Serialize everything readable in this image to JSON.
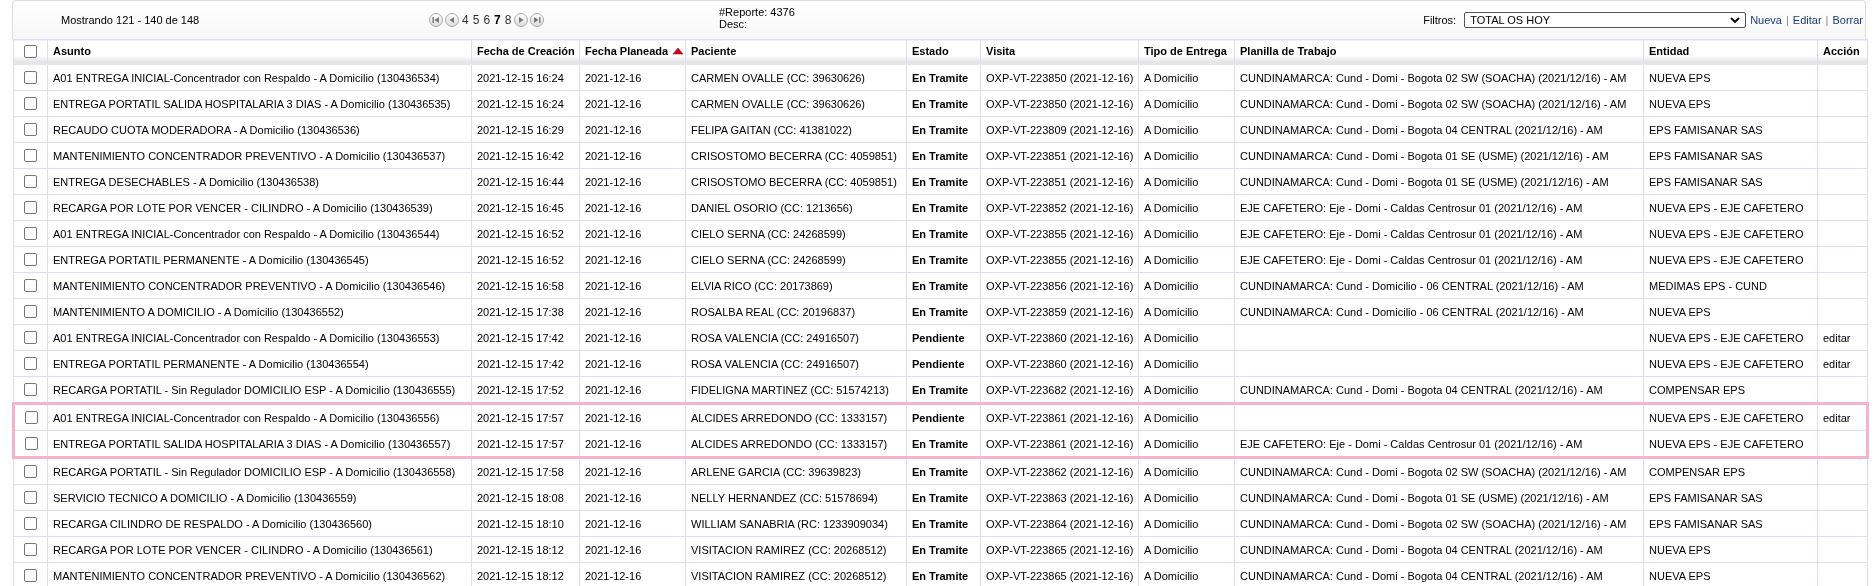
{
  "summary": "Mostrando 121 - 140 de 148",
  "pagination": {
    "pages": [
      {
        "label": "4",
        "selected": false
      },
      {
        "label": "5",
        "selected": false
      },
      {
        "label": "6",
        "selected": false
      },
      {
        "label": "7",
        "selected": true
      },
      {
        "label": "8",
        "selected": false
      }
    ]
  },
  "report": {
    "number": "#Reporte: 4376",
    "desc": "Desc:"
  },
  "filters": {
    "label": "Filtros:",
    "value": "TOTAL OS HOY",
    "links": [
      "Nueva",
      "Editar",
      "Borrar"
    ],
    "separator": "|"
  },
  "table": {
    "select_all_checked": false,
    "columns": [
      {
        "label": "Asunto"
      },
      {
        "label": "Fecha de Creación"
      },
      {
        "label": "Fecha Planeada",
        "sort_ascending": true
      },
      {
        "label": "Paciente"
      },
      {
        "label": "Estado"
      },
      {
        "label": "Visita"
      },
      {
        "label": "Tipo de Entrega"
      },
      {
        "label": "Planilla de Trabajo"
      },
      {
        "label": "Entidad"
      },
      {
        "label": "Acción"
      }
    ],
    "rows": [
      {
        "checked": false,
        "highlighted": false,
        "cells": [
          "A01 ENTREGA INICIAL-Concentrador con Respaldo - A Domicilio (130436534)",
          "2021-12-15 16:24",
          "2021-12-16",
          "CARMEN OVALLE (CC: 39630626)",
          "En Tramite",
          "OXP-VT-223850 (2021-12-16)",
          "A Domicilio",
          "CUNDINAMARCA: Cund - Domi - Bogota 02 SW (SOACHA) (2021/12/16) - AM",
          "NUEVA EPS",
          ""
        ]
      },
      {
        "checked": false,
        "highlighted": false,
        "cells": [
          "ENTREGA PORTATIL SALIDA HOSPITALARIA 3 DIAS - A Domicilio (130436535)",
          "2021-12-15 16:24",
          "2021-12-16",
          "CARMEN OVALLE (CC: 39630626)",
          "En Tramite",
          "OXP-VT-223850 (2021-12-16)",
          "A Domicilio",
          "CUNDINAMARCA: Cund - Domi - Bogota 02 SW (SOACHA) (2021/12/16) - AM",
          "NUEVA EPS",
          ""
        ]
      },
      {
        "checked": false,
        "highlighted": false,
        "cells": [
          "RECAUDO CUOTA MODERADORA - A Domicilio (130436536)",
          "2021-12-15 16:29",
          "2021-12-16",
          "FELIPA GAITAN (CC: 41381022)",
          "En Tramite",
          "OXP-VT-223809 (2021-12-16)",
          "A Domicilio",
          "CUNDINAMARCA: Cund - Domi - Bogota 04 CENTRAL (2021/12/16) - AM",
          "EPS FAMISANAR SAS",
          ""
        ]
      },
      {
        "checked": false,
        "highlighted": false,
        "cells": [
          "MANTENIMIENTO CONCENTRADOR PREVENTIVO - A Domicilio (130436537)",
          "2021-12-15 16:42",
          "2021-12-16",
          "CRISOSTOMO BECERRA (CC: 4059851)",
          "En Tramite",
          "OXP-VT-223851 (2021-12-16)",
          "A Domicilio",
          "CUNDINAMARCA: Cund - Domi - Bogota 01 SE (USME) (2021/12/16) - AM",
          "EPS FAMISANAR SAS",
          ""
        ]
      },
      {
        "checked": false,
        "highlighted": false,
        "cells": [
          "ENTREGA DESECHABLES - A Domicilio (130436538)",
          "2021-12-15 16:44",
          "2021-12-16",
          "CRISOSTOMO BECERRA (CC: 4059851)",
          "En Tramite",
          "OXP-VT-223851 (2021-12-16)",
          "A Domicilio",
          "CUNDINAMARCA: Cund - Domi - Bogota 01 SE (USME) (2021/12/16) - AM",
          "EPS FAMISANAR SAS",
          ""
        ]
      },
      {
        "checked": false,
        "highlighted": false,
        "cells": [
          "RECARGA POR LOTE POR VENCER - CILINDRO - A Domicilio (130436539)",
          "2021-12-15 16:45",
          "2021-12-16",
          "DANIEL OSORIO (CC: 1213656)",
          "En Tramite",
          "OXP-VT-223852 (2021-12-16)",
          "A Domicilio",
          "EJE CAFETERO: Eje - Domi - Caldas Centrosur 01 (2021/12/16) - AM",
          "NUEVA EPS - EJE CAFETERO",
          ""
        ]
      },
      {
        "checked": false,
        "highlighted": false,
        "cells": [
          "A01 ENTREGA INICIAL-Concentrador con Respaldo - A Domicilio (130436544)",
          "2021-12-15 16:52",
          "2021-12-16",
          "CIELO SERNA (CC: 24268599)",
          "En Tramite",
          "OXP-VT-223855 (2021-12-16)",
          "A Domicilio",
          "EJE CAFETERO: Eje - Domi - Caldas Centrosur 01 (2021/12/16) - AM",
          "NUEVA EPS - EJE CAFETERO",
          ""
        ]
      },
      {
        "checked": false,
        "highlighted": false,
        "cells": [
          "ENTREGA PORTATIL PERMANENTE - A Domicilio (130436545)",
          "2021-12-15 16:52",
          "2021-12-16",
          "CIELO SERNA (CC: 24268599)",
          "En Tramite",
          "OXP-VT-223855 (2021-12-16)",
          "A Domicilio",
          "EJE CAFETERO: Eje - Domi - Caldas Centrosur 01 (2021/12/16) - AM",
          "NUEVA EPS - EJE CAFETERO",
          ""
        ]
      },
      {
        "checked": false,
        "highlighted": false,
        "cells": [
          "MANTENIMIENTO CONCENTRADOR PREVENTIVO - A Domicilio (130436546)",
          "2021-12-15 16:58",
          "2021-12-16",
          "ELVIA RICO (CC: 20173869)",
          "En Tramite",
          "OXP-VT-223856 (2021-12-16)",
          "A Domicilio",
          "CUNDINAMARCA: Cund - Domicilio - 06 CENTRAL (2021/12/16) - AM",
          "MEDIMAS EPS - CUND",
          ""
        ]
      },
      {
        "checked": false,
        "highlighted": false,
        "cells": [
          "MANTENIMIENTO A DOMICILIO - A Domicilio (130436552)",
          "2021-12-15 17:38",
          "2021-12-16",
          "ROSALBA REAL (CC: 20196837)",
          "En Tramite",
          "OXP-VT-223859 (2021-12-16)",
          "A Domicilio",
          "CUNDINAMARCA: Cund - Domicilio - 06 CENTRAL (2021/12/16) - AM",
          "NUEVA EPS",
          ""
        ]
      },
      {
        "checked": false,
        "highlighted": false,
        "cells": [
          "A01 ENTREGA INICIAL-Concentrador con Respaldo - A Domicilio (130436553)",
          "2021-12-15 17:42",
          "2021-12-16",
          "ROSA VALENCIA (CC: 24916507)",
          "Pendiente",
          "OXP-VT-223860 (2021-12-16)",
          "A Domicilio",
          "",
          "NUEVA EPS - EJE CAFETERO",
          "editar"
        ]
      },
      {
        "checked": false,
        "highlighted": false,
        "cells": [
          "ENTREGA PORTATIL PERMANENTE - A Domicilio (130436554)",
          "2021-12-15 17:42",
          "2021-12-16",
          "ROSA VALENCIA (CC: 24916507)",
          "Pendiente",
          "OXP-VT-223860 (2021-12-16)",
          "A Domicilio",
          "",
          "NUEVA EPS - EJE CAFETERO",
          "editar"
        ]
      },
      {
        "checked": false,
        "highlighted": false,
        "cells": [
          "RECARGA PORTATIL - Sin Regulador DOMICILIO ESP - A Domicilio (130436555)",
          "2021-12-15 17:52",
          "2021-12-16",
          "FIDELIGNA MARTINEZ (CC: 51574213)",
          "En Tramite",
          "OXP-VT-223682 (2021-12-16)",
          "A Domicilio",
          "CUNDINAMARCA: Cund - Domi - Bogota 04 CENTRAL (2021/12/16) - AM",
          "COMPENSAR EPS",
          ""
        ]
      },
      {
        "checked": false,
        "highlighted": true,
        "cells": [
          "A01 ENTREGA INICIAL-Concentrador con Respaldo - A Domicilio (130436556)",
          "2021-12-15 17:57",
          "2021-12-16",
          "ALCIDES ARREDONDO (CC: 1333157)",
          "Pendiente",
          "OXP-VT-223861 (2021-12-16)",
          "A Domicilio",
          "",
          "NUEVA EPS - EJE CAFETERO",
          "editar"
        ]
      },
      {
        "checked": false,
        "highlighted": true,
        "cells": [
          "ENTREGA PORTATIL SALIDA HOSPITALARIA 3 DIAS - A Domicilio (130436557)",
          "2021-12-15 17:57",
          "2021-12-16",
          "ALCIDES ARREDONDO (CC: 1333157)",
          "En Tramite",
          "OXP-VT-223861 (2021-12-16)",
          "A Domicilio",
          "EJE CAFETERO: Eje - Domi - Caldas Centrosur 01 (2021/12/16) - AM",
          "NUEVA EPS - EJE CAFETERO",
          ""
        ]
      },
      {
        "checked": false,
        "highlighted": false,
        "cells": [
          "RECARGA PORTATIL - Sin Regulador DOMICILIO ESP - A Domicilio (130436558)",
          "2021-12-15 17:58",
          "2021-12-16",
          "ARLENE GARCIA (CC: 39639823)",
          "En Tramite",
          "OXP-VT-223862 (2021-12-16)",
          "A Domicilio",
          "CUNDINAMARCA: Cund - Domi - Bogota 02 SW (SOACHA) (2021/12/16) - AM",
          "COMPENSAR EPS",
          ""
        ]
      },
      {
        "checked": false,
        "highlighted": false,
        "cells": [
          "SERVICIO TECNICO A DOMICILIO - A Domicilio (130436559)",
          "2021-12-15 18:08",
          "2021-12-16",
          "NELLY HERNANDEZ (CC: 51578694)",
          "En Tramite",
          "OXP-VT-223863 (2021-12-16)",
          "A Domicilio",
          "CUNDINAMARCA: Cund - Domi - Bogota 01 SE (USME) (2021/12/16) - AM",
          "EPS FAMISANAR SAS",
          ""
        ]
      },
      {
        "checked": false,
        "highlighted": false,
        "cells": [
          "RECARGA CILINDRO DE RESPALDO - A Domicilio (130436560)",
          "2021-12-15 18:10",
          "2021-12-16",
          "WILLIAM SANABRIA (RC: 1233909034)",
          "En Tramite",
          "OXP-VT-223864 (2021-12-16)",
          "A Domicilio",
          "CUNDINAMARCA: Cund - Domi - Bogota 02 SW (SOACHA) (2021/12/16) - AM",
          "EPS FAMISANAR SAS",
          ""
        ]
      },
      {
        "checked": false,
        "highlighted": false,
        "cells": [
          "RECARGA POR LOTE POR VENCER - CILINDRO - A Domicilio (130436561)",
          "2021-12-15 18:12",
          "2021-12-16",
          "VISITACION RAMIREZ (CC: 20268512)",
          "En Tramite",
          "OXP-VT-223865 (2021-12-16)",
          "A Domicilio",
          "CUNDINAMARCA: Cund - Domi - Bogota 04 CENTRAL (2021/12/16) - AM",
          "NUEVA EPS",
          ""
        ]
      },
      {
        "checked": false,
        "highlighted": false,
        "cells": [
          "MANTENIMIENTO CONCENTRADOR PREVENTIVO - A Domicilio (130436562)",
          "2021-12-15 18:12",
          "2021-12-16",
          "VISITACION RAMIREZ (CC: 20268512)",
          "En Tramite",
          "OXP-VT-223865 (2021-12-16)",
          "A Domicilio",
          "CUNDINAMARCA: Cund - Domi - Bogota 04 CENTRAL (2021/12/16) - AM",
          "NUEVA EPS",
          ""
        ]
      }
    ]
  }
}
